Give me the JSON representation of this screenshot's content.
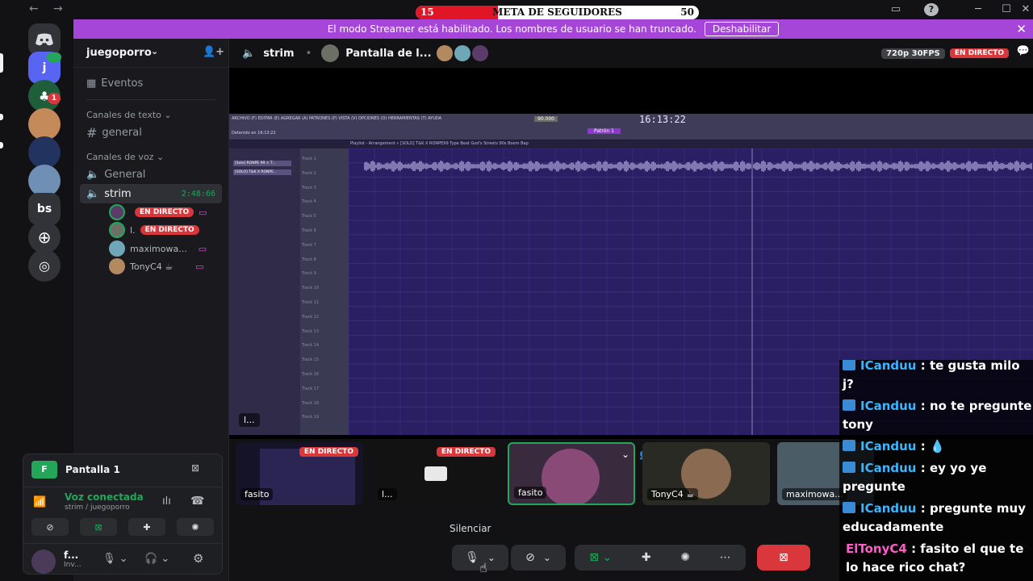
{
  "goal": {
    "start": "15",
    "title": "META DE SEGUIDORES",
    "end": "50",
    "progress": 0.29
  },
  "banner": {
    "text": "El modo Streamer está habilitado. Los nombres de usuario se han truncado.",
    "button": "Deshabilitar"
  },
  "rail": {
    "server_initial": "j",
    "badge": "1",
    "bs_label": "bs"
  },
  "guild": {
    "name": "juegoporro"
  },
  "channels": {
    "events": "Eventos",
    "text_category": "Canales de texto",
    "text_general": "general",
    "voice_category": "Canales de voz",
    "voice_general": "General",
    "voice_strim": "strim",
    "strim_time": "2:48:66"
  },
  "voice_users": [
    {
      "name": "",
      "live": "EN DIRECTO"
    },
    {
      "name": "l.",
      "live": "EN DIRECTO"
    },
    {
      "name": "maximowa...",
      "live": ""
    },
    {
      "name": "TonyC4 ☕",
      "live": ""
    }
  ],
  "rtc": {
    "title": "Pantalla 1",
    "status": "Voz conectada",
    "channel": "strim / juegoporro",
    "user": "f...",
    "user_status": "Inv..."
  },
  "header": {
    "channel": "strim",
    "sep": "•",
    "stream": "Pantalla de l...",
    "quality": "720p 30FPS",
    "live": "EN DIRECTO"
  },
  "fl": {
    "menu": "ARCHIVO (F)  EDITAR (E)  AGREGAR (A)  PATRONES (P)  VISTA (V)  OPCIONES (O)  HERRAMIENTAS (T)  AYUDA",
    "time": "16:13:22",
    "tempo": "90.000",
    "status": "Detenido en 16:13:22",
    "playlist_title": "Playlist - Arrangement » [SOLO] T&K X RONPE99 Type Beat  God's Streets  90s Boom Bap",
    "pattern": "Patrón 1",
    "clip1": "[Solo] RONPE 99 × T...",
    "clip2": "[SOLO] T&K X RONPE..",
    "tracks": [
      "Track 1",
      "Track 2",
      "Track 3",
      "Track 4",
      "Track 5",
      "Track 6",
      "Track 7",
      "Track 8",
      "Track 9",
      "Track 10",
      "Track 11",
      "Track 12",
      "Track 13",
      "Track 14",
      "Track 15",
      "Track 16",
      "Track 17",
      "Track 18",
      "Track 19"
    ],
    "stream_label": "l..."
  },
  "thumbs": [
    {
      "label": "fasito",
      "live": "EN DIRECTO"
    },
    {
      "label": "l...",
      "live": "EN DIRECTO"
    },
    {
      "label": "fasito",
      "live": ""
    },
    {
      "label": "TonyC4 ☕",
      "live": ""
    },
    {
      "label": "maximowa...",
      "live": ""
    }
  ],
  "tooltip": "Silenciar",
  "chat": [
    {
      "name": "ICanduu",
      "text": " : te gusta milo j?"
    },
    {
      "name": "ICanduu",
      "text": " : no te pregunte tony"
    },
    {
      "name": "ICanduu",
      "text": " : 💧"
    },
    {
      "name": "ICanduu",
      "text": " : ey yo ye pregunte"
    },
    {
      "name": "ICanduu",
      "text": " : pregunte muy educadamente"
    },
    {
      "name": "ElTonyC4",
      "text": " : fasito el que te lo hace rico chat?"
    }
  ]
}
